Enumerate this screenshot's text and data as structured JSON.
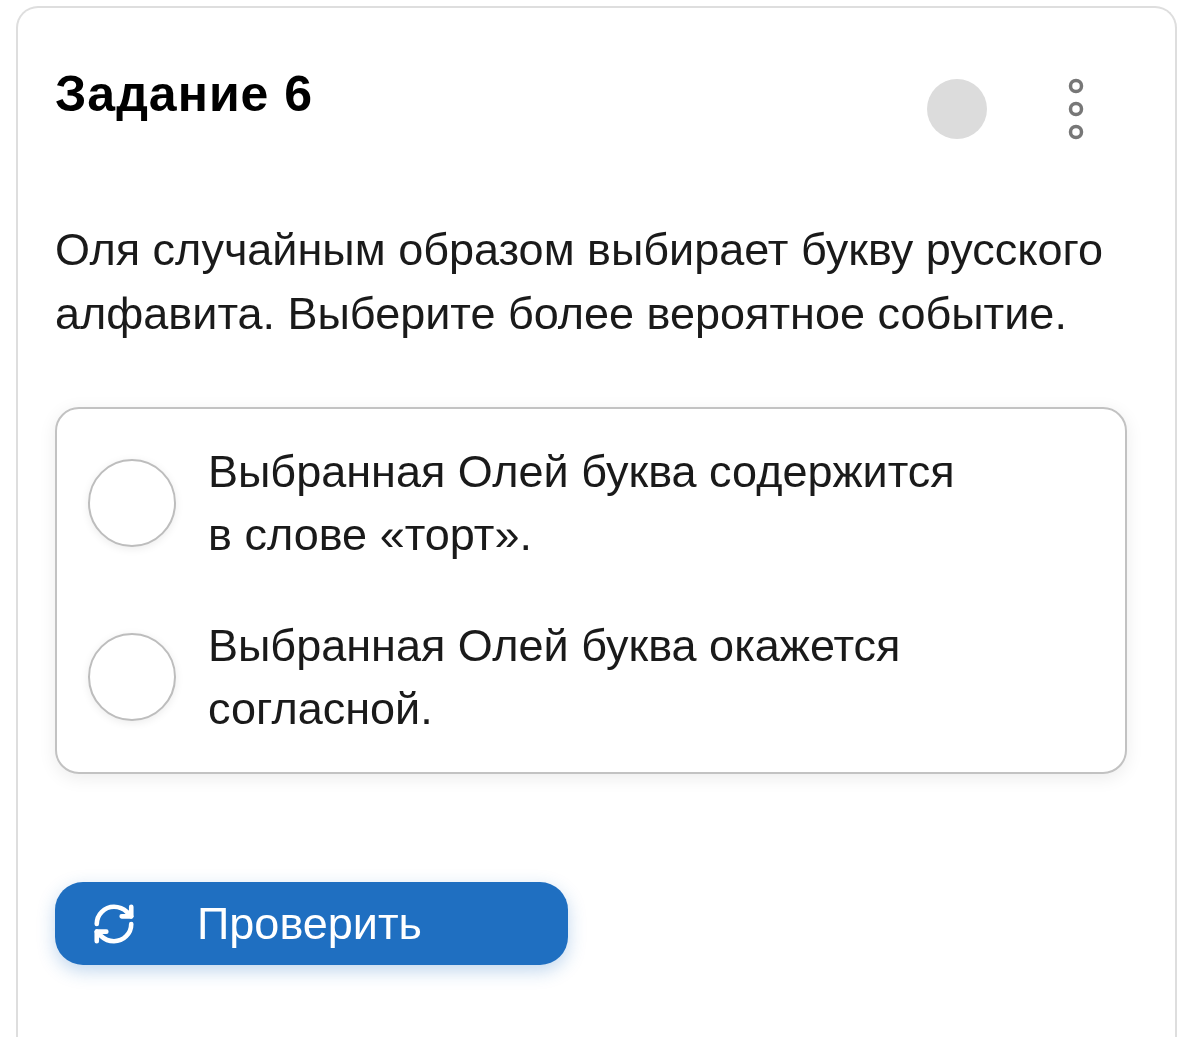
{
  "task": {
    "title": "Задание 6"
  },
  "question": "Оля случайным образом выбирает букву русского алфавита. Выберите более вероятное событие.",
  "options": [
    {
      "text": "Выбранная Олей буква содержится в слове «торт».",
      "selected": false
    },
    {
      "text": "Выбранная Олей буква окажется согласной.",
      "selected": false
    }
  ],
  "check_button": {
    "label": "Проверить"
  }
}
